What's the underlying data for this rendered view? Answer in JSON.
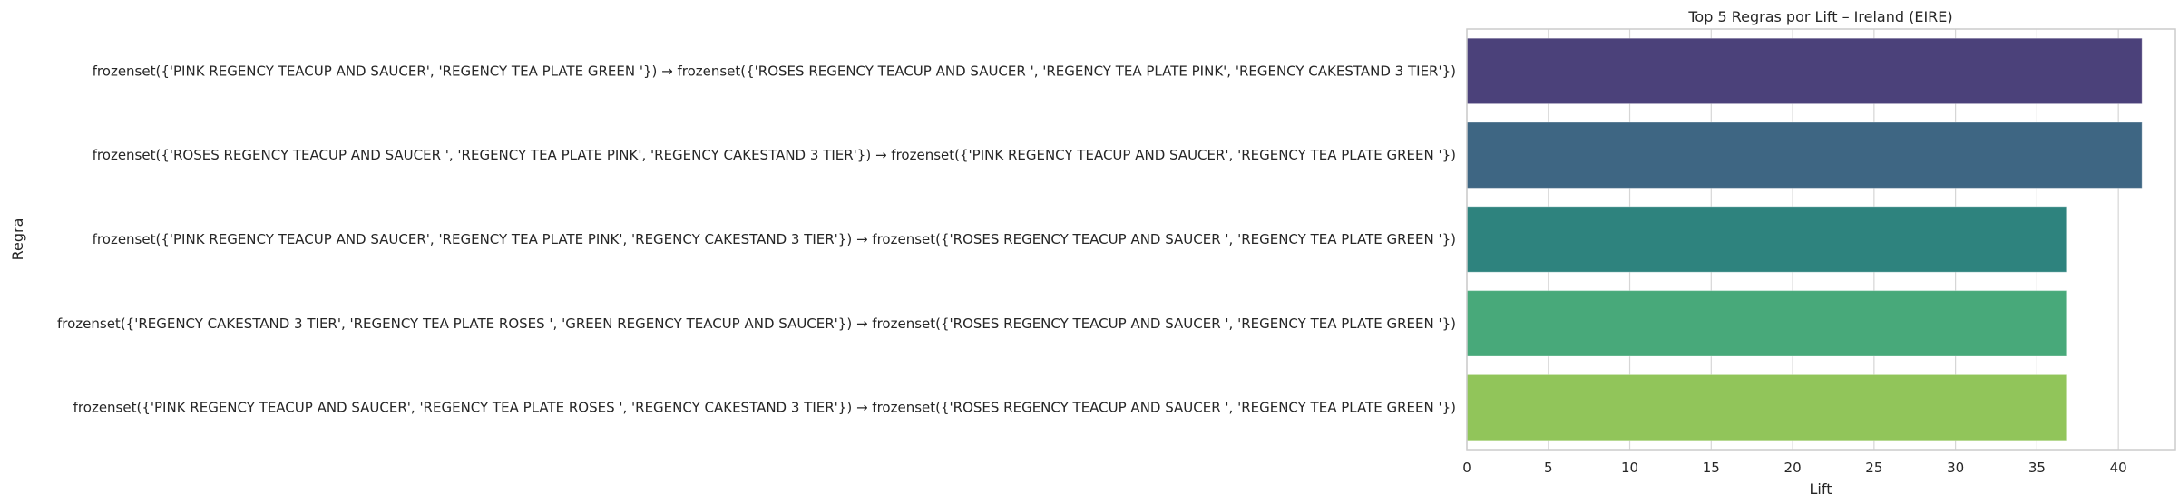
{
  "chart_data": {
    "type": "bar",
    "orientation": "horizontal",
    "title": "Top 5 Regras por Lift – Ireland (EIRE)",
    "xlabel": "Lift",
    "ylabel": "Regra",
    "xlim": [
      0,
      43.5
    ],
    "xticks": [
      0,
      5,
      10,
      15,
      20,
      25,
      30,
      35,
      40
    ],
    "grid": true,
    "categories": [
      "frozenset({'PINK REGENCY TEACUP AND SAUCER', 'REGENCY TEA PLATE GREEN '}) → frozenset({'ROSES REGENCY TEACUP AND SAUCER ', 'REGENCY TEA PLATE PINK', 'REGENCY CAKESTAND 3 TIER'})",
      "frozenset({'ROSES REGENCY TEACUP AND SAUCER ', 'REGENCY TEA PLATE PINK', 'REGENCY CAKESTAND 3 TIER'}) → frozenset({'PINK REGENCY TEACUP AND SAUCER', 'REGENCY TEA PLATE GREEN '})",
      "frozenset({'PINK REGENCY TEACUP AND SAUCER', 'REGENCY TEA PLATE PINK', 'REGENCY CAKESTAND 3 TIER'}) → frozenset({'ROSES REGENCY TEACUP AND SAUCER ', 'REGENCY TEA PLATE GREEN '})",
      "frozenset({'REGENCY CAKESTAND 3 TIER', 'REGENCY TEA PLATE ROSES ', 'GREEN REGENCY TEACUP AND SAUCER'}) → frozenset({'ROSES REGENCY TEACUP AND SAUCER ', 'REGENCY TEA PLATE GREEN '})",
      "frozenset({'PINK REGENCY TEACUP AND SAUCER', 'REGENCY TEA PLATE ROSES ', 'REGENCY CAKESTAND 3 TIER'}) → frozenset({'ROSES REGENCY TEACUP AND SAUCER ', 'REGENCY TEA PLATE GREEN '})"
    ],
    "values": [
      41.45,
      41.45,
      36.8,
      36.8,
      36.8
    ],
    "colors": [
      "#4b417a",
      "#3e6683",
      "#2e837e",
      "#48a97a",
      "#91c55a"
    ]
  }
}
